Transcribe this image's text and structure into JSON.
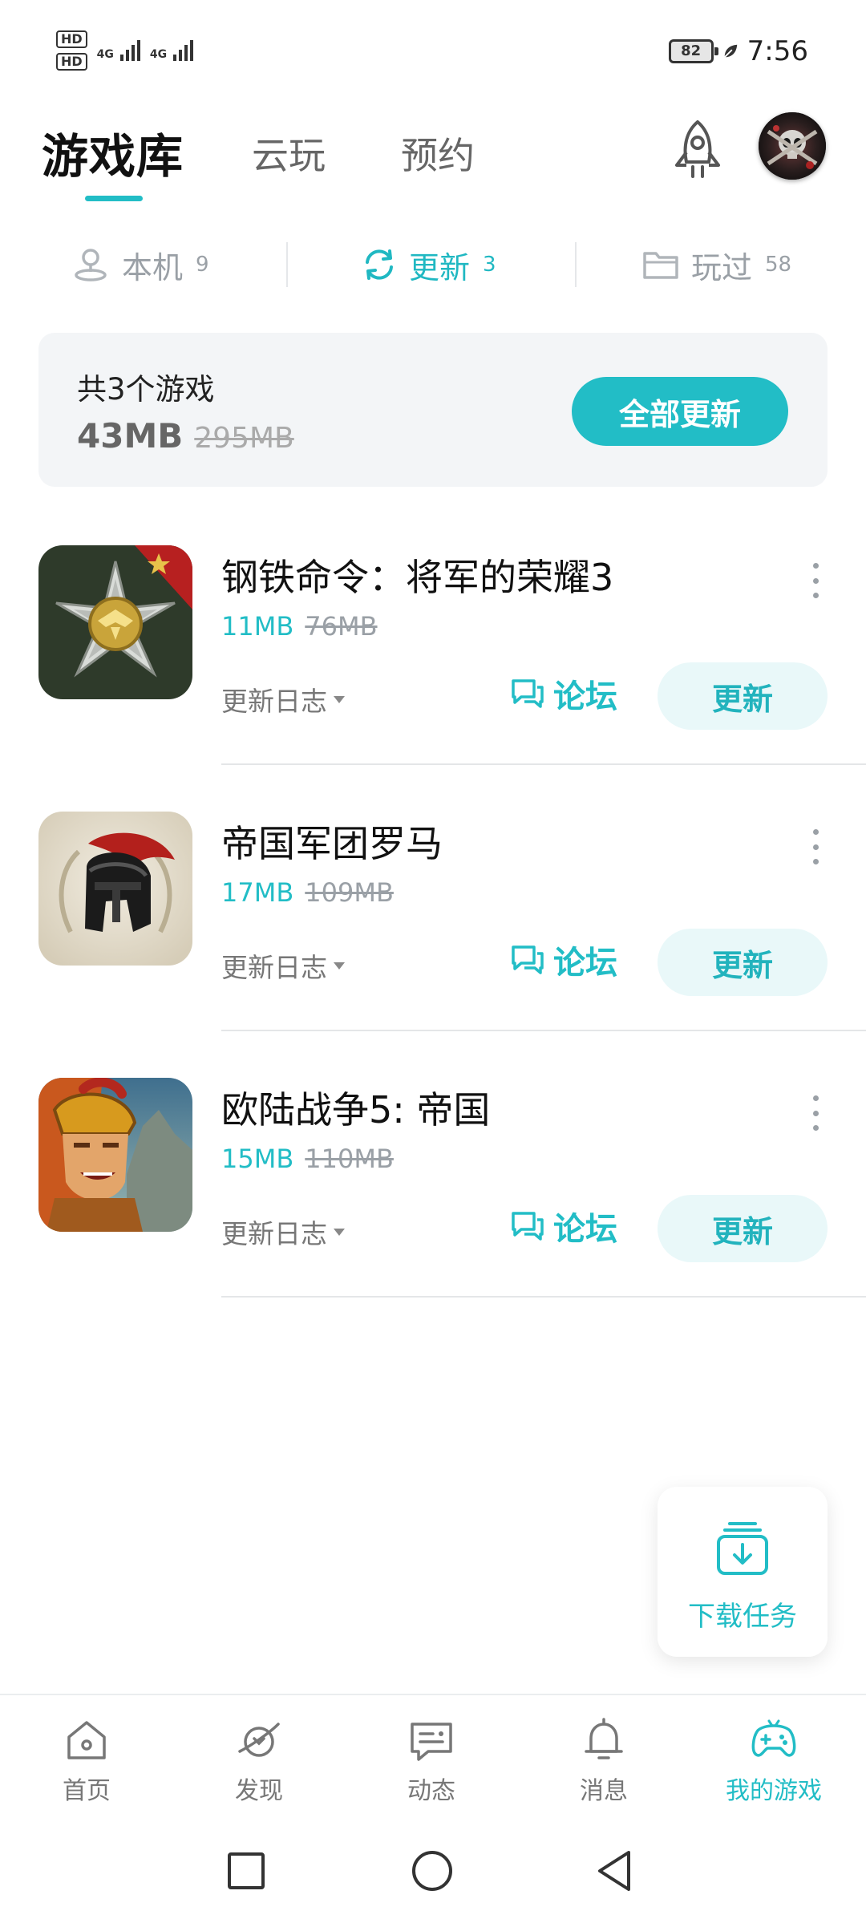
{
  "status_bar": {
    "hd1": "HD",
    "hd2": "HD",
    "net1": "4G",
    "net2": "4G",
    "battery": "82",
    "time": "7:56"
  },
  "header": {
    "tabs": [
      "游戏库",
      "云玩",
      "预约"
    ],
    "active_tab": "游戏库",
    "icons": [
      "rocket-icon",
      "avatar"
    ]
  },
  "segments": [
    {
      "label": "本机",
      "count": "9",
      "icon": "user-pin-icon",
      "active": false
    },
    {
      "label": "更新",
      "count": "3",
      "icon": "refresh-icon",
      "active": true
    },
    {
      "label": "玩过",
      "count": "58",
      "icon": "folder-icon",
      "active": false
    }
  ],
  "summary": {
    "count_text": "共3个游戏",
    "size": "43MB",
    "original_size": "295MB",
    "update_all_label": "全部更新"
  },
  "games": [
    {
      "name": "钢铁命令：将军的荣耀3",
      "size": "11MB",
      "original_size": "76MB",
      "log_label": "更新日志",
      "forum_label": "论坛",
      "update_label": "更新"
    },
    {
      "name": "帝国军团罗马",
      "size": "17MB",
      "original_size": "109MB",
      "log_label": "更新日志",
      "forum_label": "论坛",
      "update_label": "更新"
    },
    {
      "name": "欧陆战争5: 帝国",
      "size": "15MB",
      "original_size": "110MB",
      "log_label": "更新日志",
      "forum_label": "论坛",
      "update_label": "更新"
    }
  ],
  "download_task": {
    "label": "下载任务"
  },
  "bottom_nav": [
    {
      "label": "首页",
      "icon": "home-icon",
      "active": false
    },
    {
      "label": "发现",
      "icon": "planet-icon",
      "active": false
    },
    {
      "label": "动态",
      "icon": "chat-icon",
      "active": false
    },
    {
      "label": "消息",
      "icon": "bell-icon",
      "active": false
    },
    {
      "label": "我的游戏",
      "icon": "gamepad-icon",
      "active": true
    }
  ],
  "colors": {
    "accent": "#22bdc6",
    "accent_light": "#e9f8f9",
    "card_bg": "#f3f5f7",
    "muted": "#9aa0a6"
  }
}
